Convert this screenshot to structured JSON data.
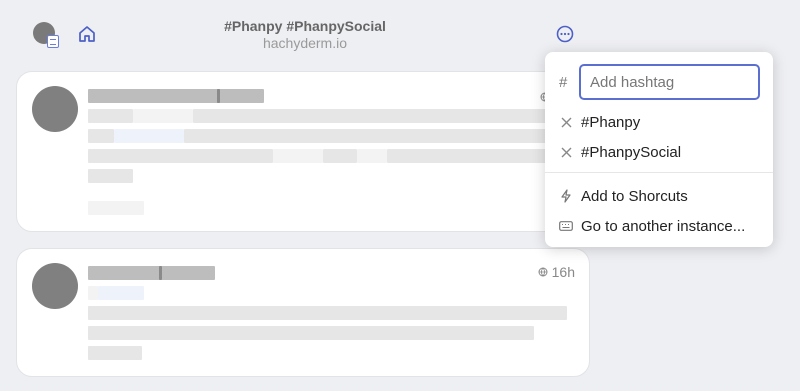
{
  "header": {
    "title": "#Phanpy #PhanpySocial",
    "subtitle": "hachyderm.io"
  },
  "posts": [
    {
      "time": ""
    },
    {
      "time": "16h"
    }
  ],
  "menu": {
    "hash_symbol": "#",
    "input_placeholder": "Add hashtag",
    "tags": [
      {
        "label": "#Phanpy"
      },
      {
        "label": "#PhanpySocial"
      }
    ],
    "actions": [
      {
        "label": "Add to Shorcuts",
        "icon": "zap-icon"
      },
      {
        "label": "Go to another instance...",
        "icon": "keyboard-icon"
      }
    ]
  },
  "colors": {
    "accent": "#5b6fd1",
    "background": "#eeeff3"
  }
}
